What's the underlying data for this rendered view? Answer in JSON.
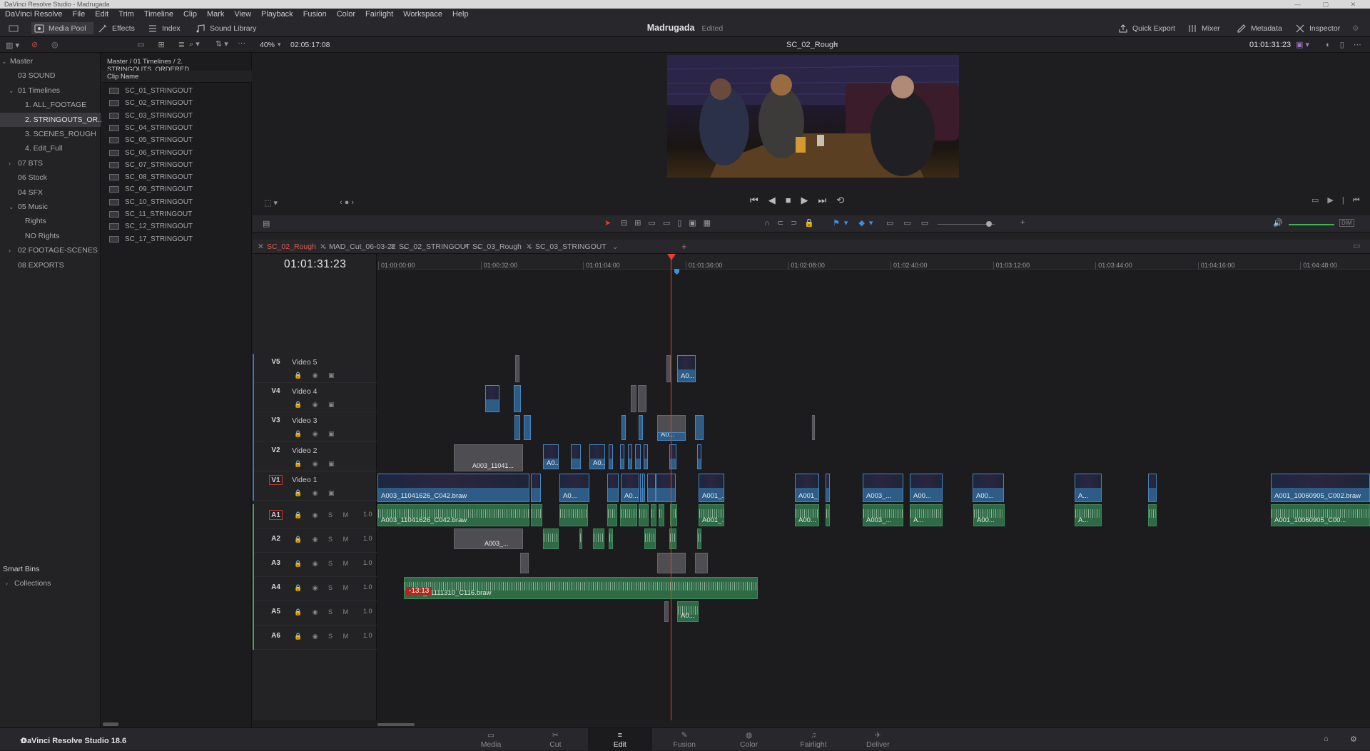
{
  "window": {
    "title": "DaVinci Resolve Studio - Madrugada"
  },
  "menu": [
    "DaVinci Resolve",
    "File",
    "Edit",
    "Trim",
    "Timeline",
    "Clip",
    "Mark",
    "View",
    "Playback",
    "Fusion",
    "Color",
    "Fairlight",
    "Workspace",
    "Help"
  ],
  "toolbar": {
    "media_pool": "Media Pool",
    "effects": "Effects",
    "index": "Index",
    "sound_library": "Sound Library",
    "project": "Madrugada",
    "status": "Edited",
    "quick_export": "Quick Export",
    "mixer": "Mixer",
    "metadata": "Metadata",
    "inspector": "Inspector"
  },
  "viewer": {
    "zoom": "40%",
    "duration": "02:05:17:08",
    "timeline_name": "SC_02_Rough",
    "timecode": "01:01:31:23"
  },
  "bins": {
    "items": [
      {
        "label": "Master",
        "level": 0,
        "arrow": "v"
      },
      {
        "label": "03 SOUND",
        "level": 1
      },
      {
        "label": "01 Timelines",
        "level": 1,
        "arrow": "v"
      },
      {
        "label": "1. ALL_FOOTAGE",
        "level": 2
      },
      {
        "label": "2. STRINGOUTS_OR...",
        "level": 2,
        "selected": true
      },
      {
        "label": "3. SCENES_ROUGH",
        "level": 2
      },
      {
        "label": "4. Edit_Full",
        "level": 2
      },
      {
        "label": "07 BTS",
        "level": 1,
        "arrow": ">"
      },
      {
        "label": "06 Stock",
        "level": 1
      },
      {
        "label": "04 SFX",
        "level": 1
      },
      {
        "label": "05 Music",
        "level": 1,
        "arrow": "v"
      },
      {
        "label": "Rights",
        "level": 2
      },
      {
        "label": "NO Rights",
        "level": 2
      },
      {
        "label": "02 FOOTAGE-SCENES",
        "level": 1,
        "arrow": ">"
      },
      {
        "label": "08 EXPORTS",
        "level": 1
      }
    ],
    "smart_bins": "Smart Bins",
    "collections": "Collections"
  },
  "pool": {
    "breadcrumb": "Master / 01 Timelines / 2. STRINGOUTS_ORDERED",
    "column": "Clip Name",
    "clips": [
      "SC_01_STRINGOUT",
      "SC_02_STRINGOUT",
      "SC_03_STRINGOUT",
      "SC_04_STRINGOUT",
      "SC_05_STRINGOUT",
      "SC_06_STRINGOUT",
      "SC_07_STRINGOUT",
      "SC_08_STRINGOUT",
      "SC_09_STRINGOUT",
      "SC_10_STRINGOUT",
      "SC_11_STRINGOUT",
      "SC_12_STRINGOUT",
      "SC_17_STRINGOUT"
    ]
  },
  "timeline_tabs": [
    "SC_02_Rough",
    "MAD_Cut_06-03-22",
    "SC_02_STRINGOUT",
    "SC_03_Rough",
    "SC_03_STRINGOUT"
  ],
  "timecode": "01:01:31:23",
  "ruler": [
    "01:00:00:00",
    "01:00:32:00",
    "01:01:04:00",
    "01:01:36:00",
    "01:02:08:00",
    "01:02:40:00",
    "01:03:12:00",
    "01:03:44:00",
    "01:04:16:00",
    "01:04:48:00"
  ],
  "video_tracks": [
    {
      "tag": "V5",
      "name": "Video 5"
    },
    {
      "tag": "V4",
      "name": "Video 4"
    },
    {
      "tag": "V3",
      "name": "Video 3"
    },
    {
      "tag": "V2",
      "name": "Video 2"
    },
    {
      "tag": "V1",
      "name": "Video 1"
    }
  ],
  "audio_tracks": [
    {
      "tag": "A1",
      "vol": "1.0"
    },
    {
      "tag": "A2",
      "vol": "1.0"
    },
    {
      "tag": "A3",
      "vol": "1.0"
    },
    {
      "tag": "A4",
      "vol": "1.0"
    },
    {
      "tag": "A5",
      "vol": "1.0"
    },
    {
      "tag": "A6",
      "vol": "1.0"
    }
  ],
  "clips": {
    "v1_main": "A003_11041626_C042.braw",
    "v1_end": "A001_10060905_C002.braw",
    "v2_red": "A003_11041...",
    "v5_a": "A0...",
    "a1_main": "A003_11041626_C042.braw",
    "a1_end": "A001_10060905_C00...",
    "a2_red": "A003_...",
    "a4_main": "A001_11111310_C116.braw",
    "a4_offset": "-13:13",
    "short_a": "A0...",
    "short_b": "A00...",
    "short_c": "A001_...",
    "short_d": "A003_...",
    "short_e": "A..."
  },
  "pages": [
    "Media",
    "Cut",
    "Edit",
    "Fusion",
    "Color",
    "Fairlight",
    "Deliver"
  ],
  "footer": {
    "version": "DaVinci Resolve Studio 18.6"
  },
  "colors": {
    "playhead": "#e7412c",
    "video_clip": "#2d5c87",
    "audio_clip": "#2e6a45",
    "active_tab": "#e05a4a"
  }
}
